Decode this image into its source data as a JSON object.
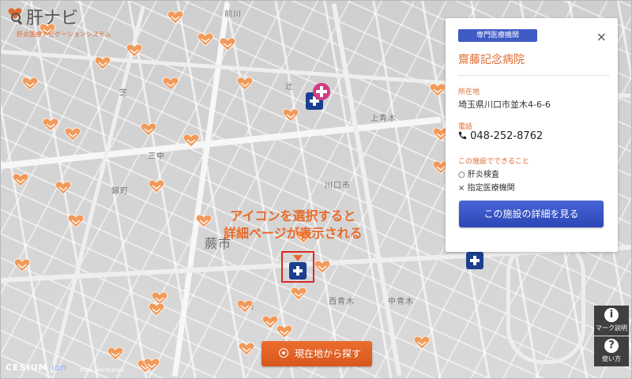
{
  "app": {
    "title": "肝ナビ",
    "subtitle": "肝炎医療ナビゲーションシステム"
  },
  "map": {
    "labels": [
      "前川",
      "上青木",
      "辻",
      "芝",
      "蕨市",
      "西青木",
      "中青木",
      "錦町",
      "川口市",
      "三中",
      "幸町"
    ],
    "callout_line1": "アイコンを選択すると",
    "callout_line2": "詳細ページが表示される"
  },
  "panel": {
    "category_badge": "専門医療機関",
    "close_label": "×",
    "hospital_name": "齋藤記念病院",
    "address_label": "所在地",
    "address": "埼玉県川口市並木4-6-6",
    "phone_label": "電話",
    "phone": "048-252-8762",
    "features_label": "この施設でできること",
    "features": [
      {
        "mark": "○",
        "text": "肝炎検査"
      },
      {
        "mark": "×",
        "text": "指定医療機関"
      }
    ],
    "detail_button": "この施設の詳細を見る"
  },
  "controls": {
    "locate_button": "現在地から探す",
    "legend_button": "マーク説明",
    "help_button": "使い方"
  },
  "footer": {
    "cesium": "CESIUM",
    "ion": "ion",
    "attribution": "Data attribution"
  },
  "colors": {
    "accent_orange": "#e06a2e",
    "primary_blue": "#2b46b5",
    "pin_heart": "#f29a5a",
    "hospital_navy": "#1b3e8f",
    "highlight_red": "#d92b24"
  }
}
